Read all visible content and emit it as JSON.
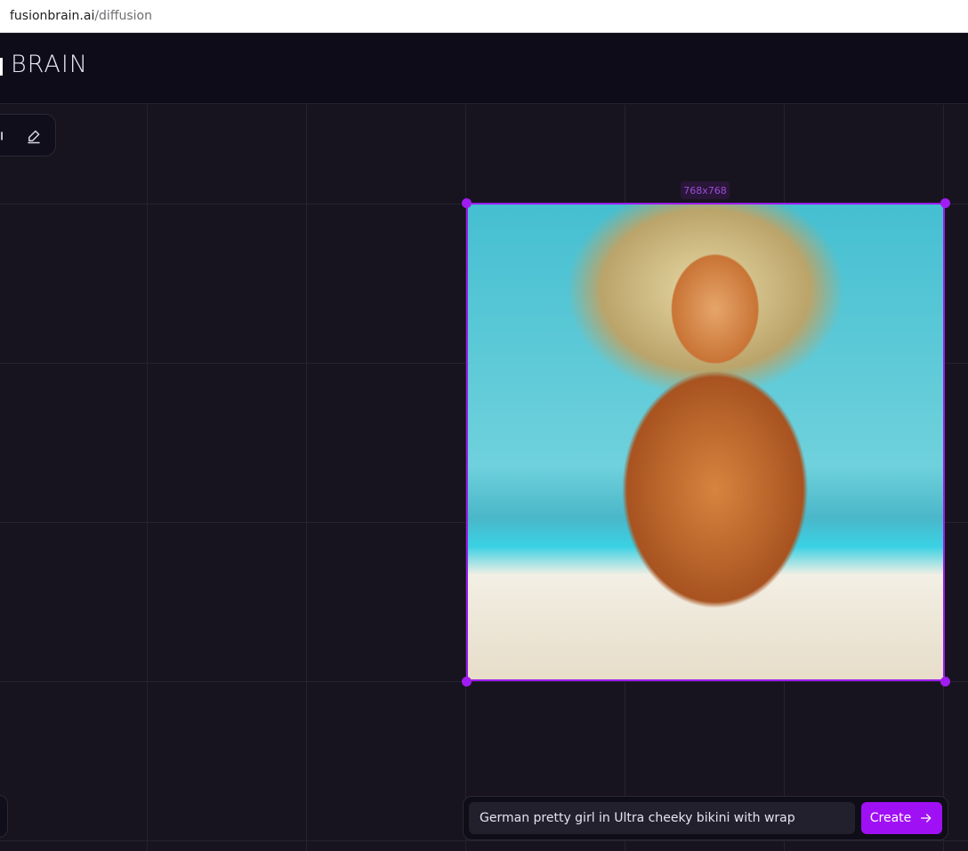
{
  "browser": {
    "url_host": "fusionbrain.ai",
    "url_path": "/diffusion"
  },
  "header": {
    "logo_text": "BRAIN"
  },
  "toolbar": {
    "eraser_icon": "eraser-icon"
  },
  "canvas": {
    "image_size_label": "768x768",
    "image_description": ""
  },
  "prompt": {
    "value": "German pretty girl in Ultra cheeky bikini with wrap",
    "create_label": "Create",
    "create_icon": "arrow-right-icon"
  },
  "colors": {
    "accent": "#a010f5",
    "selection": "#9d1cf0",
    "background": "#17141f",
    "header": "#0e0c19"
  }
}
